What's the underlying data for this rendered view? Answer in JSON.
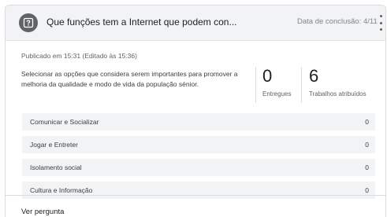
{
  "header": {
    "icon": "assignment-question-icon",
    "title": "Que funções tem a Internet que podem con...",
    "due": "Data de conclusão: 4/11",
    "more_icon": "more-vert-icon"
  },
  "body": {
    "posted": "Publicado em 15:31 (Editado às 15:36)",
    "description": "Selecionar as opções que considera serem importantes para promover a melhoria da qualidade e modo de vida da população sénior."
  },
  "stats": {
    "turned_in": {
      "value": "0",
      "label": "Entregues"
    },
    "assigned": {
      "value": "6",
      "label": "Trabalhos atribuídos"
    }
  },
  "options": [
    {
      "label": "Comunicar e Socializar",
      "count": "0"
    },
    {
      "label": "Jogar e Entreter",
      "count": "0"
    },
    {
      "label": "Isolamento social",
      "count": "0"
    },
    {
      "label": "Cultura e Informação",
      "count": "0"
    }
  ],
  "footer": {
    "view_question": "Ver pergunta"
  }
}
